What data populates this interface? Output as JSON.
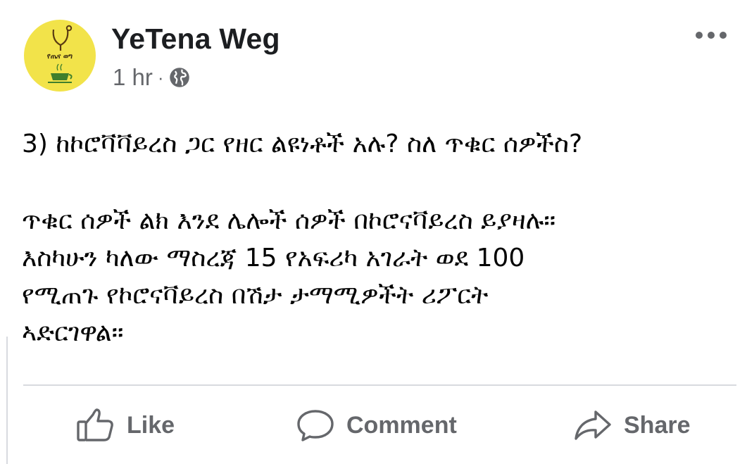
{
  "post": {
    "page_name": "YeTena Weg",
    "avatar_text": "የጤና ወግ",
    "time": "1 hr",
    "separator": "·",
    "audience_icon": "globe-icon",
    "more_icon": "more-options-icon",
    "body": {
      "question": "3) ከኮሮቫቫይረስ ጋር የዘር ልዩነቶች አሉ? ስለ ጥቁር ሰዎችስ?",
      "answer_lines": [
        "ጥቁር ሰዎች ልክ እንደ ሌሎች ሰዎች በኮሮናቫይረስ ይያዛሉ።",
        "እስካሁን ካለው ማስረጃ 15 የአፍሪካ አገራት ወደ 100",
        "የሚጠጉ የኮሮናቫይረስ በሽታ ታማሚዎችት ሪፖርት",
        "ኣድርገዋል።"
      ]
    }
  },
  "actions": {
    "like": {
      "label": "Like",
      "icon": "thumbs-up-icon"
    },
    "comment": {
      "label": "Comment",
      "icon": "comment-bubble-icon"
    },
    "share": {
      "label": "Share",
      "icon": "share-arrow-icon"
    }
  },
  "colors": {
    "text": "#050505",
    "secondary": "#65676b",
    "divider": "#d8dadf",
    "avatar_bg": "#f2e34a"
  }
}
